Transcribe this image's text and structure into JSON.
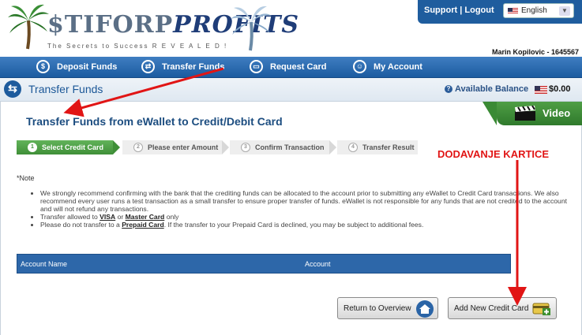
{
  "header": {
    "logo_text_a": "$TIFORP",
    "logo_text_b": "PROFITS",
    "logo_tagline": "The Secrets to Success R E V E A L E D !",
    "support_link": "Support",
    "separator": "|",
    "logout_link": "Logout",
    "language": "English",
    "user": "Marin Kopilovic - 1645567"
  },
  "nav": {
    "items": [
      {
        "label": "Deposit Funds",
        "icon": "$"
      },
      {
        "label": "Transfer Funds",
        "icon": "⇄"
      },
      {
        "label": "Request Card",
        "icon": "▭"
      },
      {
        "label": "My Account",
        "icon": "☺"
      }
    ]
  },
  "pagebar": {
    "title": "Transfer Funds",
    "available_label": "Available Balance",
    "balance": "$0.00"
  },
  "main": {
    "heading": "Transfer Funds from eWallet to Credit/Debit Card",
    "video_label": "Video",
    "steps": [
      {
        "num": "1",
        "label": "Select Credit Card"
      },
      {
        "num": "2",
        "label": "Please enter Amount"
      },
      {
        "num": "3",
        "label": "Confirm Transaction"
      },
      {
        "num": "4",
        "label": "Transfer Result"
      }
    ],
    "note_title": "*Note",
    "note1": "We strongly recommend confirming with the bank that the crediting funds can be allocated to the account prior to submitting any eWallet to Credit Card transactions. We also recommend every user runs a test transaction as a small transfer to ensure proper transfer of funds. eWallet is not responsible for any funds that are not credited to the account and will not refund any transactions.",
    "note2_prefix": "Transfer allowed to ",
    "note2_visa": "VISA",
    "note2_or": " or ",
    "note2_master": "Master Card",
    "note2_suffix": " only",
    "note3_prefix": "Please do not transfer to a ",
    "note3_prepaid": "Prepaid Card",
    "note3_suffix": ". If the transfer to your Prepaid Card is declined, you may be subject to additional fees.",
    "table_headers": [
      "Account Name",
      "Account"
    ],
    "annotation": "DODAVANJE KARTICE",
    "btn_return": "Return to Overview",
    "btn_add": "Add New Credit Card"
  },
  "colors": {
    "nav_blue": "#1c5ba0",
    "step_green": "#3f8f38",
    "annotation_red": "#e11515"
  }
}
